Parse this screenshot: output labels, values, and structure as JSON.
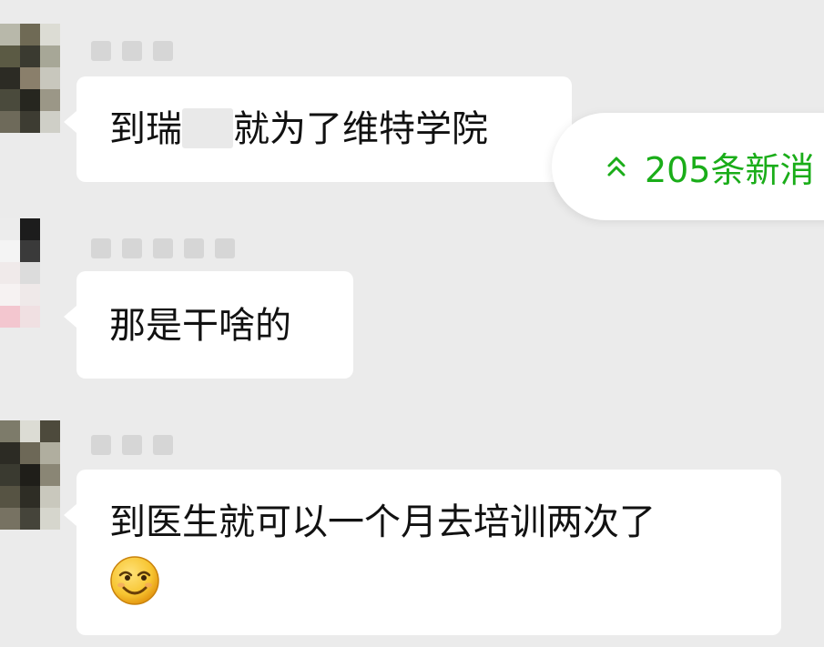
{
  "messages": [
    {
      "text_before": "到瑞",
      "text_after": "就为了维特学院"
    },
    {
      "text": "那是干啥的"
    },
    {
      "text": "到医生就可以一个月去培训两次了",
      "emoji": "smiling-face-emoji"
    }
  ],
  "new_messages_pill": {
    "label": "205条新消",
    "icon": "double-chevron-up-icon",
    "color": "#1aad19"
  },
  "colors": {
    "background": "#ebebeb",
    "bubble": "#ffffff",
    "accent_green": "#1aad19"
  }
}
